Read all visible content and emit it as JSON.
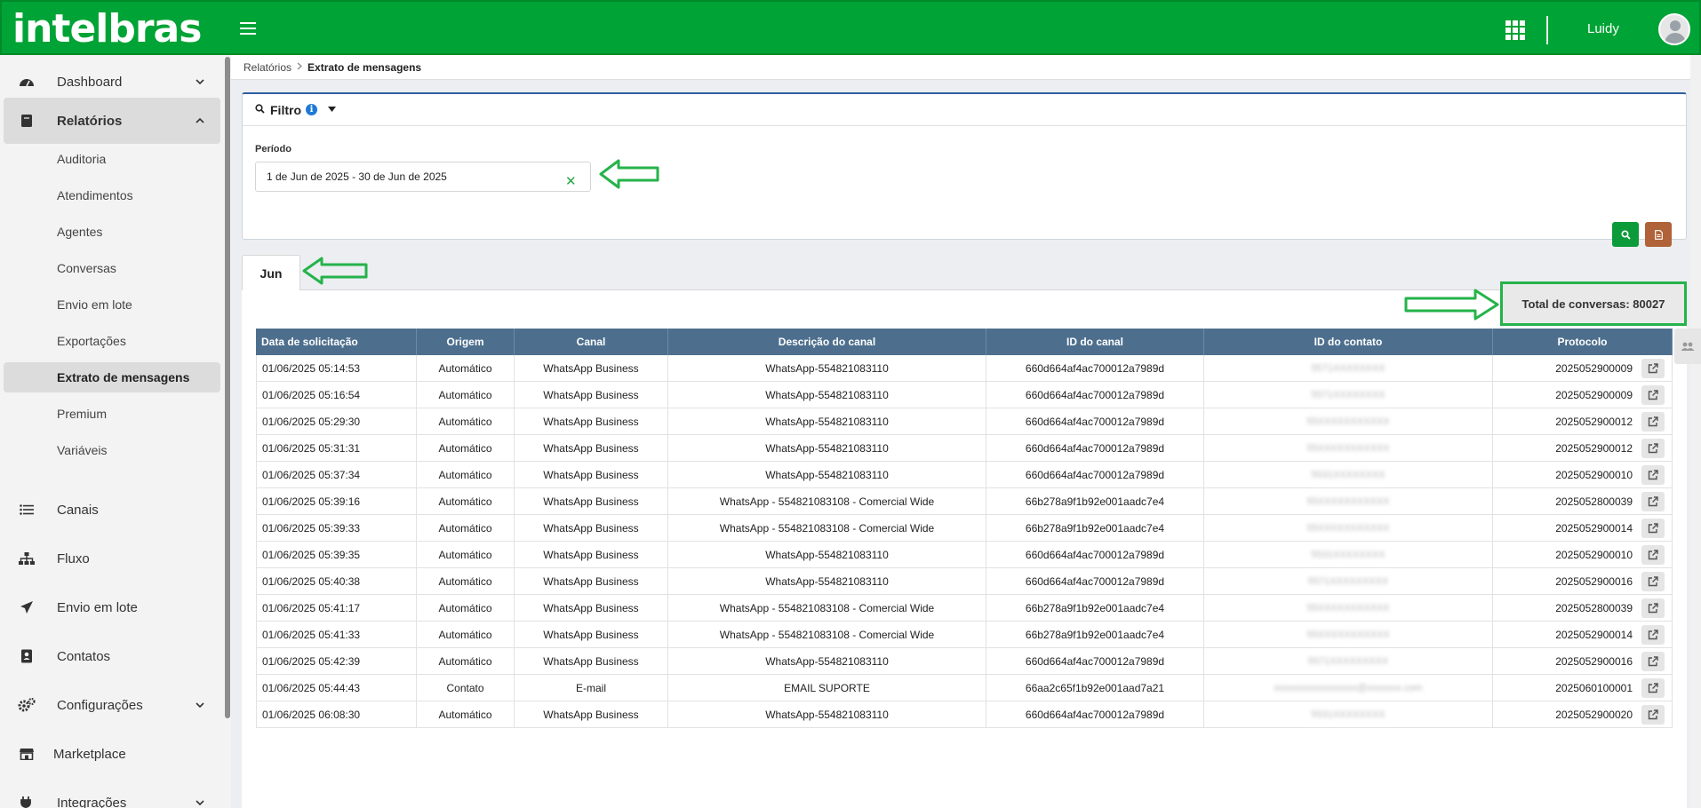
{
  "header": {
    "logo_text": "intelbras",
    "user_name": "Luidy"
  },
  "sidebar": {
    "items": [
      {
        "label": "Dashboard",
        "icon": "dashboard-gauge-icon",
        "chevron": "⌄"
      },
      {
        "label": "Relatórios",
        "icon": "book-icon",
        "chevron": "⌃"
      },
      {
        "label": "Canais",
        "icon": "list-icon"
      },
      {
        "label": "Fluxo",
        "icon": "sitemap-icon"
      },
      {
        "label": "Envio em lote",
        "icon": "paper-plane-icon"
      },
      {
        "label": "Contatos",
        "icon": "address-book-icon"
      },
      {
        "label": "Configurações",
        "icon": "cogs-icon",
        "chevron": "⌄"
      },
      {
        "label": "Marketplace",
        "icon": "store-icon"
      },
      {
        "label": "Integrações",
        "icon": "plug-icon",
        "chevron": "⌄"
      }
    ],
    "sub_items": [
      {
        "label": "Auditoria"
      },
      {
        "label": "Atendimentos"
      },
      {
        "label": "Agentes"
      },
      {
        "label": "Conversas"
      },
      {
        "label": "Envio em lote"
      },
      {
        "label": "Exportações"
      },
      {
        "label": "Extrato de mensagens"
      },
      {
        "label": "Premium"
      },
      {
        "label": "Variáveis"
      }
    ]
  },
  "breadcrumb": {
    "parent": "Relatórios",
    "current": "Extrato de mensagens"
  },
  "filter": {
    "title": "Filtro",
    "period_label": "Período",
    "period_value": "1 de Jun de 2025 - 30 de Jun de 2025"
  },
  "tabs": [
    {
      "label": "Jun"
    }
  ],
  "summary": {
    "total_label": "Total de conversas: 80027"
  },
  "table": {
    "columns": [
      "Data de solicitação",
      "Origem",
      "Canal",
      "Descrição do canal",
      "ID do canal",
      "ID do contato",
      "Protocolo"
    ],
    "rows": [
      [
        "01/06/2025 05:14:53",
        "Automático",
        "WhatsApp Business",
        "WhatsApp-554821083110",
        "660d664af4ac700012a7989d",
        "5571XXXXXXXX",
        "2025052900009"
      ],
      [
        "01/06/2025 05:16:54",
        "Automático",
        "WhatsApp Business",
        "WhatsApp-554821083110",
        "660d664af4ac700012a7989d",
        "5571XXXXXXXX",
        "2025052900009"
      ],
      [
        "01/06/2025 05:29:30",
        "Automático",
        "WhatsApp Business",
        "WhatsApp-554821083110",
        "660d664af4ac700012a7989d",
        "55XXXXXXXXXXX",
        "2025052900012"
      ],
      [
        "01/06/2025 05:31:31",
        "Automático",
        "WhatsApp Business",
        "WhatsApp-554821083110",
        "660d664af4ac700012a7989d",
        "55XXXXXXXXXXX",
        "2025052900012"
      ],
      [
        "01/06/2025 05:37:34",
        "Automático",
        "WhatsApp Business",
        "WhatsApp-554821083110",
        "660d664af4ac700012a7989d",
        "5531XXXXXXXX",
        "2025052900010"
      ],
      [
        "01/06/2025 05:39:16",
        "Automático",
        "WhatsApp Business",
        "WhatsApp - 554821083108 - Comercial Wide",
        "66b278a9f1b92e001aadc7e4",
        "55XXXXXXXXXXX",
        "2025052800039"
      ],
      [
        "01/06/2025 05:39:33",
        "Automático",
        "WhatsApp Business",
        "WhatsApp - 554821083108 - Comercial Wide",
        "66b278a9f1b92e001aadc7e4",
        "55XXXXXXXXXXX",
        "2025052900014"
      ],
      [
        "01/06/2025 05:39:35",
        "Automático",
        "WhatsApp Business",
        "WhatsApp-554821083110",
        "660d664af4ac700012a7989d",
        "5531XXXXXXXX",
        "2025052900010"
      ],
      [
        "01/06/2025 05:40:38",
        "Automático",
        "WhatsApp Business",
        "WhatsApp-554821083110",
        "660d664af4ac700012a7989d",
        "5571XXXXXXXXX",
        "2025052900016"
      ],
      [
        "01/06/2025 05:41:17",
        "Automático",
        "WhatsApp Business",
        "WhatsApp - 554821083108 - Comercial Wide",
        "66b278a9f1b92e001aadc7e4",
        "55XXXXXXXXXXX",
        "2025052800039"
      ],
      [
        "01/06/2025 05:41:33",
        "Automático",
        "WhatsApp Business",
        "WhatsApp - 554821083108 - Comercial Wide",
        "66b278a9f1b92e001aadc7e4",
        "55XXXXXXXXXXX",
        "2025052900014"
      ],
      [
        "01/06/2025 05:42:39",
        "Automático",
        "WhatsApp Business",
        "WhatsApp-554821083110",
        "660d664af4ac700012a7989d",
        "5571XXXXXXXXX",
        "2025052900016"
      ],
      [
        "01/06/2025 05:44:43",
        "Contato",
        "E-mail",
        "EMAIL SUPORTE",
        "66aa2c65f1b92e001aad7a21",
        "xxxxxxxxxxxxxxxxx@xxxxxxx.com",
        "2025060100001"
      ],
      [
        "01/06/2025 06:08:30",
        "Automático",
        "WhatsApp Business",
        "WhatsApp-554821083110",
        "660d664af4ac700012a7989d",
        "5531XXXXXXXX",
        "2025052900020"
      ]
    ]
  },
  "colors": {
    "brand_green": "#00a335",
    "table_header": "#4d6f8d",
    "annotation_green": "#25b34a",
    "export_button": "#b06238"
  }
}
